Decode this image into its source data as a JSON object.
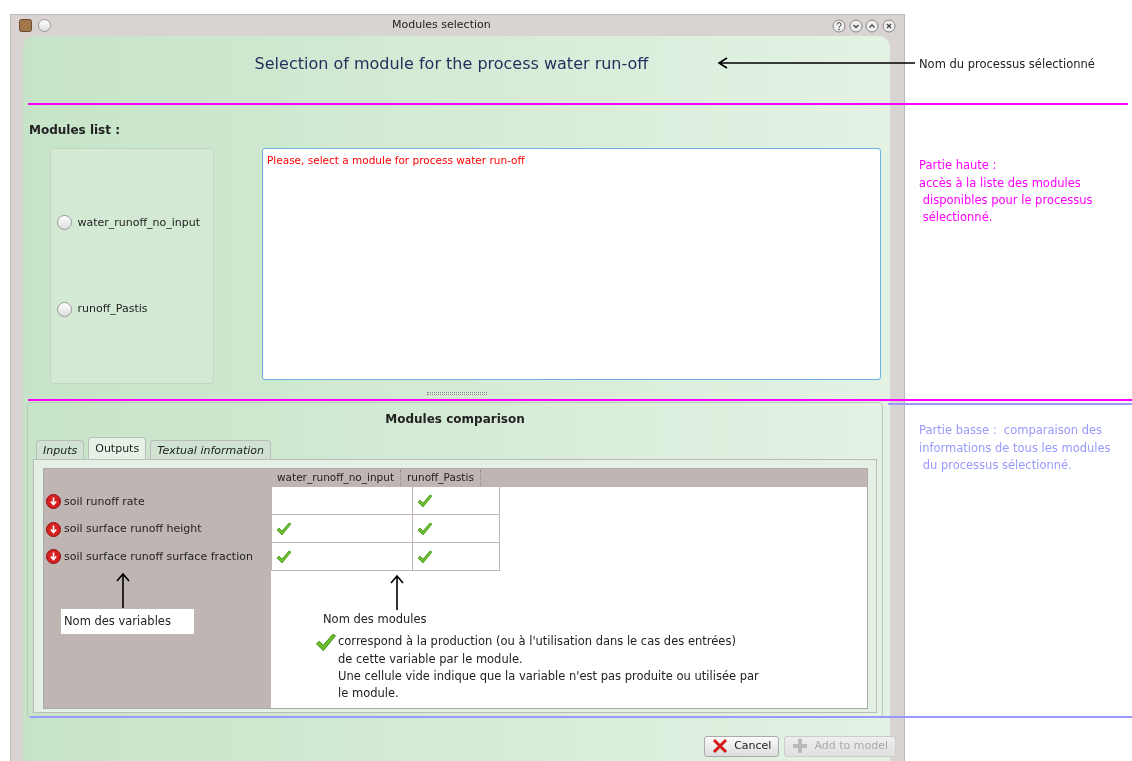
{
  "window": {
    "title": "Modules selection"
  },
  "header": {
    "title": "Selection of module for the process water run-off"
  },
  "modules_list": {
    "label": "Modules list :",
    "modules": [
      {
        "label": "water_runoff_no_input",
        "selected": false
      },
      {
        "label": "runoff_Pastis",
        "selected": false
      }
    ],
    "message": "Please, select a module for process  water run-off"
  },
  "comparison": {
    "title": "Modules comparison",
    "tabs": [
      {
        "label": "Inputs",
        "selected": false
      },
      {
        "label": "Outputs",
        "selected": true
      },
      {
        "label": "Textual information",
        "selected": false
      }
    ],
    "columns": [
      "water_runoff_no_input",
      "runoff_Pastis"
    ],
    "rows": [
      {
        "variable": "soil runoff rate",
        "cells": [
          {
            "checked": false
          },
          {
            "checked": true
          }
        ]
      },
      {
        "variable": "soil surface runoff height",
        "cells": [
          {
            "checked": true
          },
          {
            "checked": true
          }
        ]
      },
      {
        "variable": "soil surface runoff surface fraction",
        "cells": [
          {
            "checked": true
          },
          {
            "checked": true
          }
        ]
      }
    ]
  },
  "buttons": [
    {
      "label": "Cancel",
      "kind": "cancel",
      "disabled": false
    },
    {
      "label": "Add to model",
      "kind": "add",
      "disabled": true
    }
  ],
  "annotations": {
    "process_name": "Nom du processus sélectionné",
    "top_part": {
      "text": "Partie haute :\naccès à la liste des modules\n disponibles pour le processus\n sélectionné.",
      "color": "#ff00ff"
    },
    "bottom_part": {
      "text": "Partie basse :  comparaison des\ninformations de tous les modules\n du processus sélectionné.",
      "color": "#9999ff"
    },
    "variables_name": "Nom des variables",
    "modules_name": "Nom des modules",
    "legend": "correspond à la production (ou à l'utilisation dans le cas des entrées)\nde cette variable par le module.\nUne cellule vide indique que la variable n'est pas produite ou utilisée par\nle module."
  }
}
